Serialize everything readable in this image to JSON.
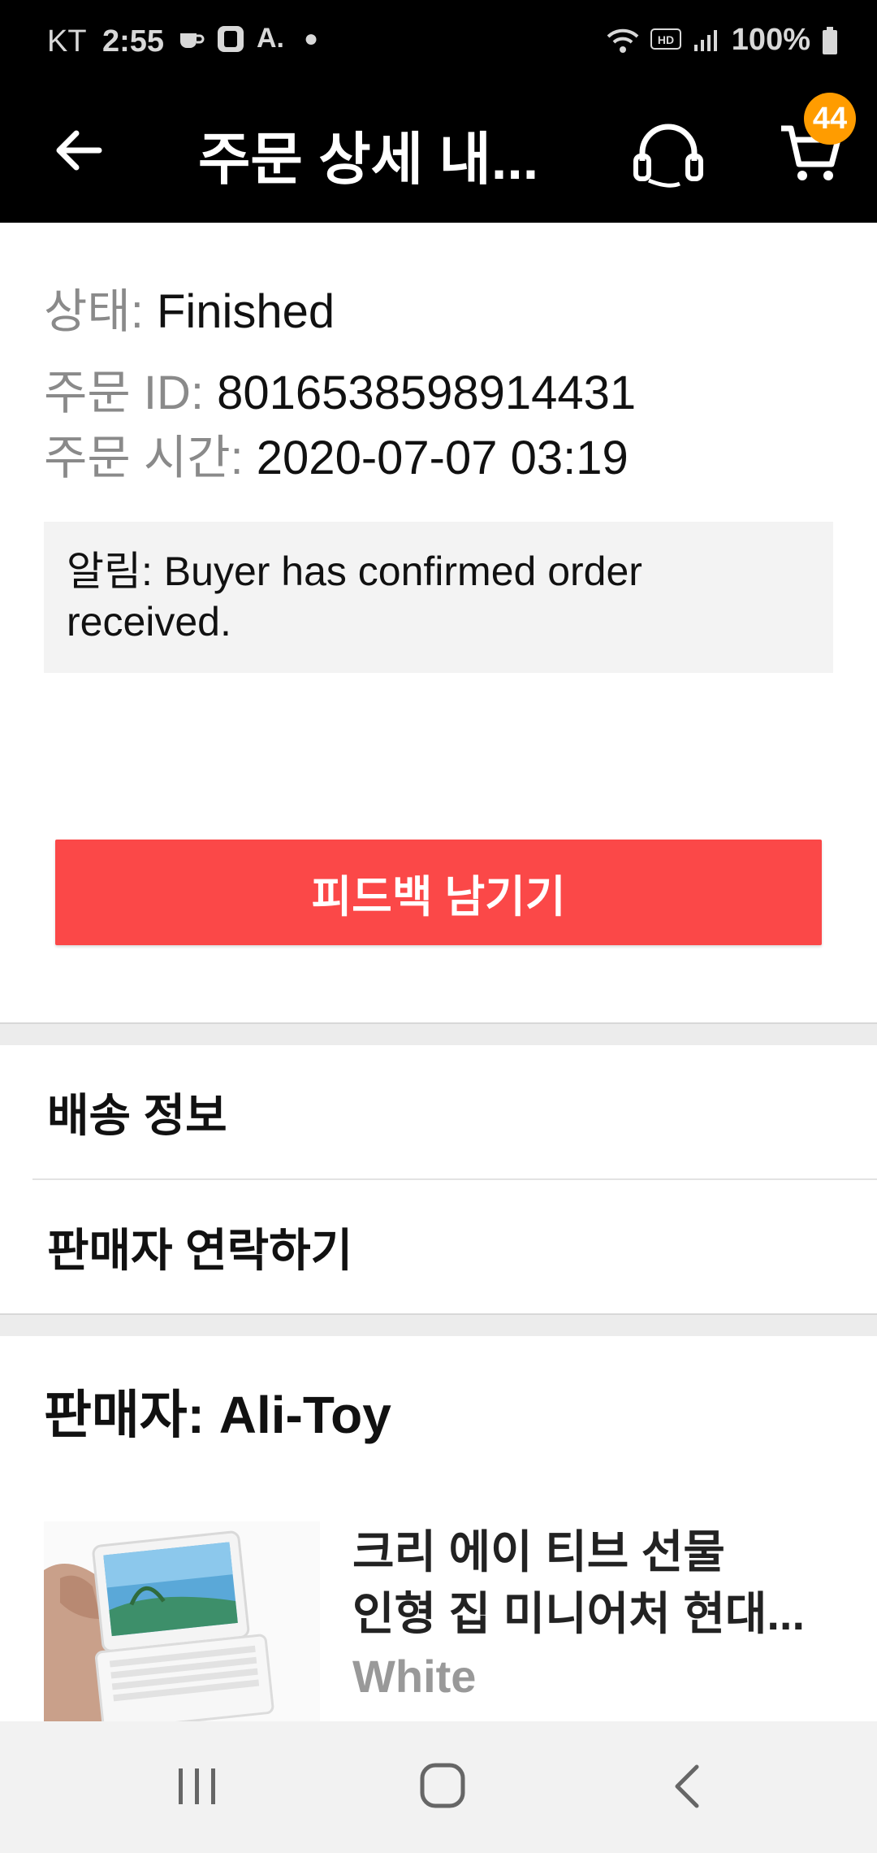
{
  "status_bar": {
    "carrier": "KT",
    "time": "2:55",
    "battery": "100%"
  },
  "header": {
    "title": "주문 상세 내...",
    "cart_count": "44"
  },
  "order": {
    "status_label": "상태: ",
    "status_value": "Finished",
    "id_label": "주문 ID: ",
    "id_value": "8016538598914431",
    "time_label": "주문 시간: ",
    "time_value": "2020-07-07 03:19"
  },
  "notice": {
    "line1": "알림: Buyer has confirmed order",
    "line2": "received."
  },
  "actions": {
    "feedback_label": "피드백 남기기"
  },
  "menu": {
    "shipping_info": "배송 정보",
    "contact_seller": "판매자 연락하기"
  },
  "seller": {
    "label": "판매자: Ali-Toy"
  },
  "product": {
    "title_line1": "크리 에이 티브 선물",
    "title_line2": "인형 집 미니어처 현대...",
    "variant": "White"
  },
  "colors": {
    "accent": "#fb4848",
    "badge": "#ff9c00"
  }
}
